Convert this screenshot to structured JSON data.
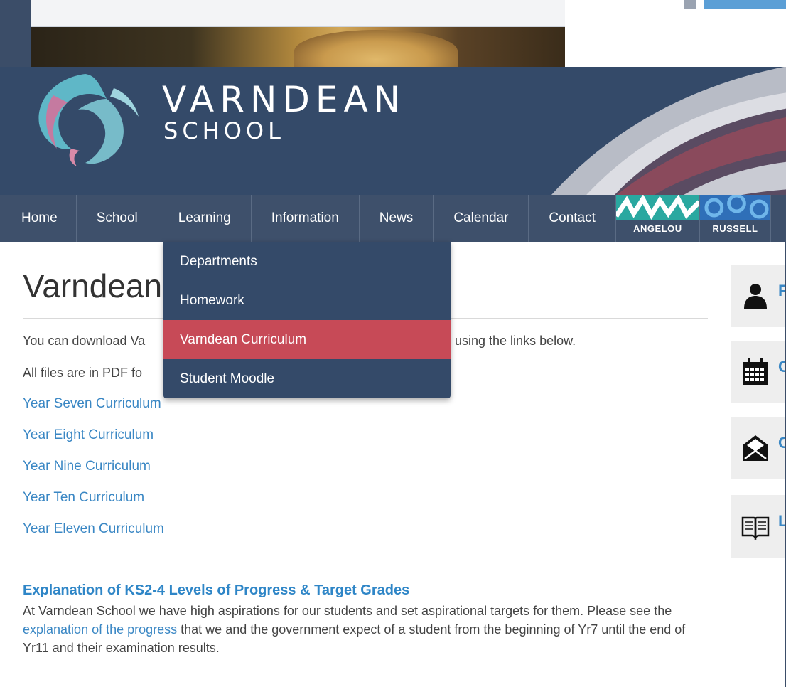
{
  "header": {
    "logo_title": "VARNDEAN",
    "logo_subtitle": "SCHOOL"
  },
  "nav": {
    "items": [
      {
        "label": "Home"
      },
      {
        "label": "School"
      },
      {
        "label": "Learning"
      },
      {
        "label": "Information"
      },
      {
        "label": "News"
      },
      {
        "label": "Calendar"
      },
      {
        "label": "Contact"
      }
    ],
    "houses": [
      {
        "label": "ANGELOU",
        "color": "#2aa8a0"
      },
      {
        "label": "RUSSELL",
        "color": "#2f6fb8"
      }
    ]
  },
  "dropdown": {
    "items": [
      {
        "label": "Departments"
      },
      {
        "label": "Homework"
      },
      {
        "label": "Varndean Curriculum",
        "active": true
      },
      {
        "label": "Student Moodle"
      }
    ]
  },
  "content": {
    "title": "Varndean",
    "intro_start": "You can download Va",
    "intro_end": "using the links below.",
    "pdf_note": "All files are in PDF fo",
    "links": [
      "Year Seven Curriculum",
      "Year Eight Curriculum",
      "Year Nine Curriculum",
      "Year Ten Curriculum",
      "Year Eleven Curriculum"
    ],
    "section_heading": "Explanation of KS2-4 Levels of Progress & Target Grades",
    "section_text_1": "At Varndean School we have high aspirations for our students and set aspirational targets for them. Please see the ",
    "section_link": "explanation of the progress",
    "section_text_2": " that we and the government expect of a student from the beginning of Yr7 until the end of Yr11 and their examination results."
  },
  "sidebar": {
    "tiles": [
      {
        "icon": "person-icon",
        "peek": "F"
      },
      {
        "icon": "calendar-icon",
        "peek": "C"
      },
      {
        "icon": "envelope-icon",
        "peek": "C"
      },
      {
        "icon": "book-icon",
        "peek": "L"
      }
    ]
  },
  "colors": {
    "header_bg": "#344a69",
    "nav_bg": "#3e506b",
    "active_item": "#c74a57",
    "link": "#3a87c4"
  }
}
